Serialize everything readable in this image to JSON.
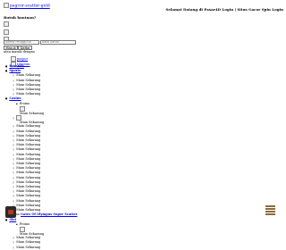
{
  "header": {
    "logo_alt": "pagcor-scatter-gold",
    "welcome": "Selamat Datang di Pasar4D Login | Situs Gacor Spin Login",
    "help": "Butuh bantuan?"
  },
  "login": {
    "username_placeholder": "Nama Pengguna",
    "password_placeholder": "Kata Sandi",
    "masuk_label": "Masuk",
    "daftar_label": "Daftar",
    "forgot": "atau masuk dengan"
  },
  "side_images": [
    "paspor",
    "Isikoran"
  ],
  "menu": {
    "beranda": "Beranda",
    "sports": "Sports",
    "sports_items": [
      "Main Sekarang",
      "Main Sekarang",
      "Main Sekarang",
      "Main Sekarang",
      "Main Sekarang"
    ],
    "casino": "Casino",
    "casino_promo": "Promo",
    "casino_items": [
      "Main Sekarang",
      "Main Sekarang",
      "Main Sekarang",
      "Main Sekarang",
      "Main Sekarang",
      "Main Sekarang",
      "Main Sekarang",
      "Main Sekarang",
      "Main Sekarang",
      "Main Sekarang",
      "Main Sekarang",
      "Main Sekarang",
      "Main Sekarang",
      "Main Sekarang",
      "Main Sekarang",
      "Main Sekarang",
      "Main Sekarang",
      "Main Sekarang",
      "Main Sekarang",
      "Main Sekarang",
      "Main Sekarang"
    ],
    "promo_label": "Promo",
    "promo_feature": "Gates Of Olympus Super Scatter",
    "slot": "Slot",
    "slot_promo": "Promo",
    "slot_items": [
      "Main Sekarang",
      "Main Sekarang",
      "Main Sekarang",
      "Main Sekarang"
    ]
  }
}
